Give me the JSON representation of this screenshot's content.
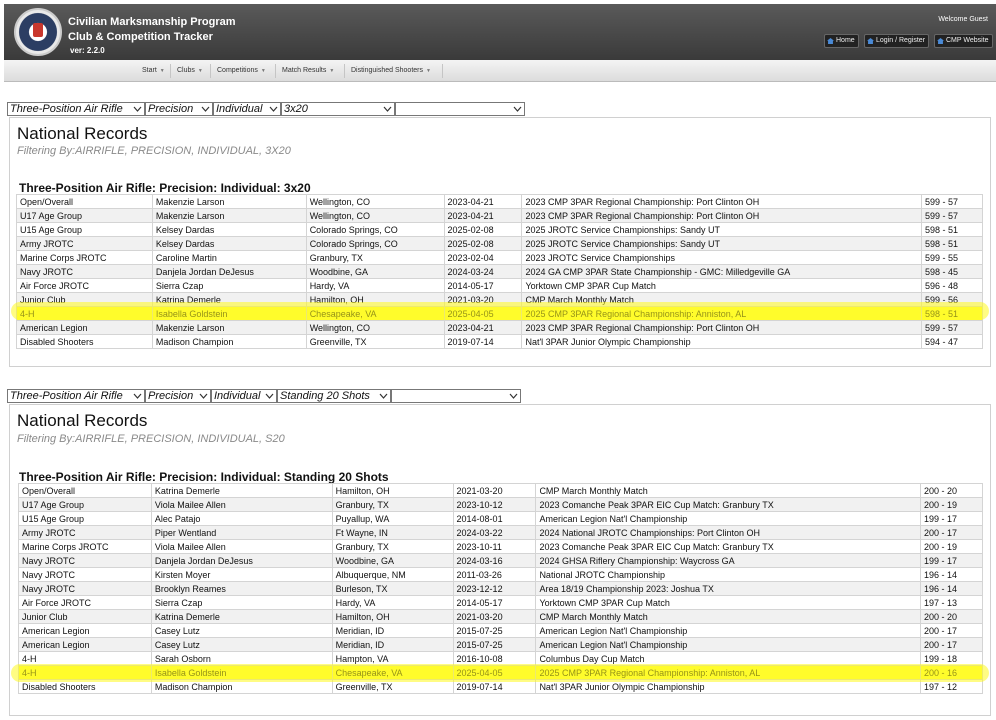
{
  "header": {
    "title": "Civilian Marksmanship Program",
    "subtitle": "Club & Competition Tracker",
    "version": "ver: 2.2.0",
    "welcome": "Welcome Guest",
    "buttons": [
      "Home",
      "Login / Register",
      "CMP Website"
    ]
  },
  "nav": {
    "items": [
      "Start",
      "Clubs",
      "Competitions",
      "Match Results",
      "Distinguished Shooters"
    ]
  },
  "section1": {
    "filters": [
      "Three-Position Air Rifle",
      "Precision",
      "Individual",
      "3x20",
      ""
    ],
    "title": "National Records",
    "filter_text": "Filtering By:AIRRIFLE, PRECISION, INDIVIDUAL, 3X20",
    "heading": "Three-Position Air Rifle: Precision: Individual: 3x20",
    "highlight_row": 8,
    "rows": [
      [
        "Open/Overall",
        "Makenzie Larson",
        "Wellington, CO",
        "2023-04-21",
        "2023 CMP 3PAR Regional Championship: Port Clinton OH",
        "599 - 57"
      ],
      [
        "U17 Age Group",
        "Makenzie Larson",
        "Wellington, CO",
        "2023-04-21",
        "2023 CMP 3PAR Regional Championship: Port Clinton OH",
        "599 - 57"
      ],
      [
        "U15 Age Group",
        "Kelsey Dardas",
        "Colorado Springs, CO",
        "2025-02-08",
        "2025 JROTC Service Championships: Sandy UT",
        "598 - 51"
      ],
      [
        "Army JROTC",
        "Kelsey Dardas",
        "Colorado Springs, CO",
        "2025-02-08",
        "2025 JROTC Service Championships: Sandy UT",
        "598 - 51"
      ],
      [
        "Marine Corps JROTC",
        "Caroline Martin",
        "Granbury, TX",
        "2023-02-04",
        "2023 JROTC Service Championships",
        "599 - 55"
      ],
      [
        "Navy JROTC",
        "Danjela Jordan DeJesus",
        "Woodbine, GA",
        "2024-03-24",
        "2024 GA CMP 3PAR State Championship - GMC: Milledgeville GA",
        "598 - 45"
      ],
      [
        "Air Force JROTC",
        "Sierra Czap",
        "Hardy, VA",
        "2014-05-17",
        "Yorktown CMP 3PAR Cup Match",
        "596 - 48"
      ],
      [
        "Junior Club",
        "Katrina Demerle",
        "Hamilton, OH",
        "2021-03-20",
        "CMP March Monthly Match",
        "599 - 56"
      ],
      [
        "4-H",
        "Isabella Goldstein",
        "Chesapeake, VA",
        "2025-04-05",
        "2025 CMP 3PAR Regional Championship: Anniston, AL",
        "598 - 51"
      ],
      [
        "American Legion",
        "Makenzie Larson",
        "Wellington, CO",
        "2023-04-21",
        "2023 CMP 3PAR Regional Championship: Port Clinton OH",
        "599 - 57"
      ],
      [
        "Disabled Shooters",
        "Madison Champion",
        "Greenville, TX",
        "2019-07-14",
        "Nat'l 3PAR Junior Olympic Championship",
        "594 - 47"
      ]
    ]
  },
  "section2": {
    "filters": [
      "Three-Position Air Rifle",
      "Precision",
      "Individual",
      "Standing 20 Shots",
      ""
    ],
    "title": "National Records",
    "filter_text": "Filtering By:AIRRIFLE, PRECISION, INDIVIDUAL, S20",
    "heading": "Three-Position Air Rifle: Precision: Individual: Standing 20 Shots",
    "highlight_row": 13,
    "rows": [
      [
        "Open/Overall",
        "Katrina Demerle",
        "Hamilton, OH",
        "2021-03-20",
        "CMP March Monthly Match",
        "200 - 20"
      ],
      [
        "U17 Age Group",
        "Viola Mailee Allen",
        "Granbury, TX",
        "2023-10-12",
        "2023 Comanche Peak 3PAR EIC Cup Match: Granbury TX",
        "200 - 19"
      ],
      [
        "U15 Age Group",
        "Alec Patajo",
        "Puyallup, WA",
        "2014-08-01",
        "American Legion Nat'l Championship",
        "199 - 17"
      ],
      [
        "Army JROTC",
        "Piper Wentland",
        "Ft Wayne, IN",
        "2024-03-22",
        "2024 National JROTC Championships: Port Clinton OH",
        "200 - 17"
      ],
      [
        "Marine Corps JROTC",
        "Viola Mailee Allen",
        "Granbury, TX",
        "2023-10-11",
        "2023 Comanche Peak 3PAR EIC Cup Match: Granbury TX",
        "200 - 19"
      ],
      [
        "Navy JROTC",
        "Danjela Jordan DeJesus",
        "Woodbine, GA",
        "2024-03-16",
        "2024 GHSA Riflery Championship: Waycross GA",
        "199 - 17"
      ],
      [
        "Navy JROTC",
        "Kirsten Moyer",
        "Albuquerque, NM",
        "2011-03-26",
        "National JROTC Championship",
        "196 - 14"
      ],
      [
        "Navy JROTC",
        "Brooklyn Reames",
        "Burleson, TX",
        "2023-12-12",
        "Area 18/19 Championship 2023: Joshua TX",
        "196 - 14"
      ],
      [
        "Air Force JROTC",
        "Sierra Czap",
        "Hardy, VA",
        "2014-05-17",
        "Yorktown CMP 3PAR Cup Match",
        "197 - 13"
      ],
      [
        "Junior Club",
        "Katrina Demerle",
        "Hamilton, OH",
        "2021-03-20",
        "CMP March Monthly Match",
        "200 - 20"
      ],
      [
        "American Legion",
        "Casey Lutz",
        "Meridian, ID",
        "2015-07-25",
        "American Legion Nat'l Championship",
        "200 - 17"
      ],
      [
        "American Legion",
        "Casey Lutz",
        "Meridian, ID",
        "2015-07-25",
        "American Legion Nat'l Championship",
        "200 - 17"
      ],
      [
        "4-H",
        "Sarah Osborn",
        "Hampton, VA",
        "2016-10-08",
        "Columbus Day Cup Match",
        "199 - 18"
      ],
      [
        "4-H",
        "Isabella Goldstein",
        "Chesapeake, VA",
        "2025-04-05",
        "2025 CMP 3PAR Regional Championship: Anniston, AL",
        "200 - 16"
      ],
      [
        "Disabled Shooters",
        "Madison Champion",
        "Greenville, TX",
        "2019-07-14",
        "Nat'l 3PAR Junior Olympic Championship",
        "197 - 12"
      ]
    ]
  },
  "colors": {
    "header_bg": "#4a4a4a",
    "highlight": "#ffff3d",
    "row_alt": "#f1f1f1"
  }
}
